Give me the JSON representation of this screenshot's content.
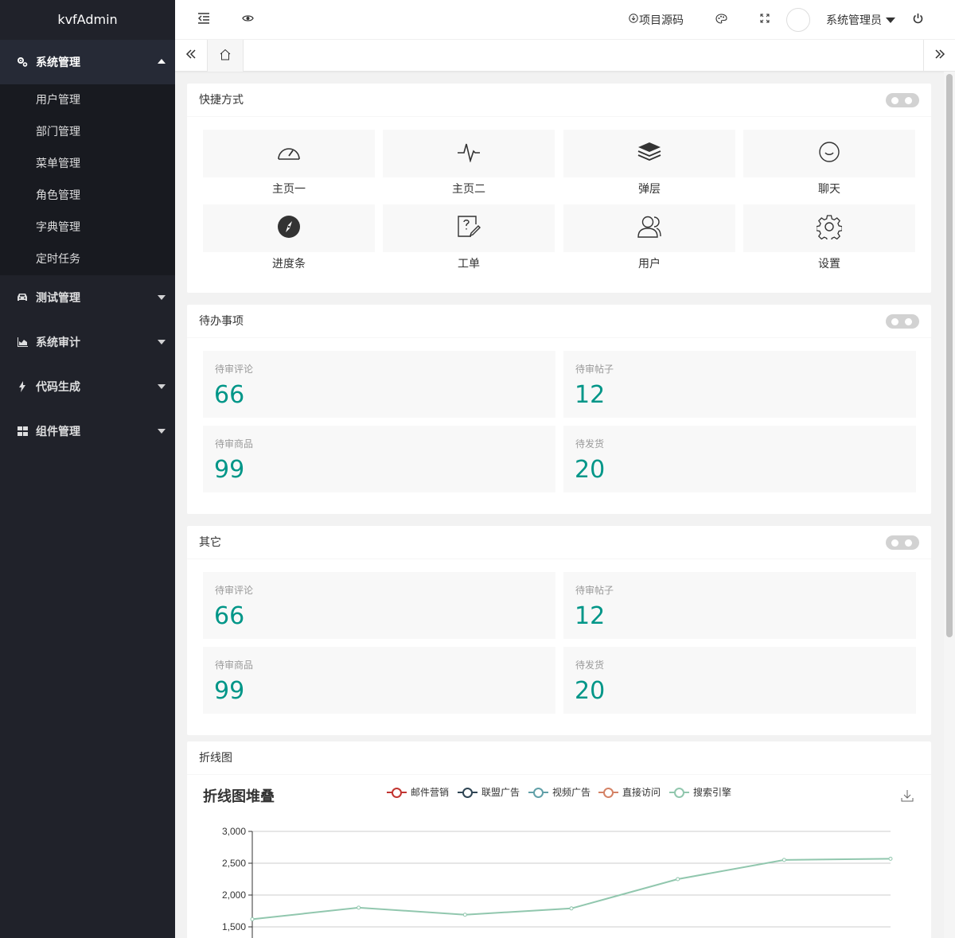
{
  "app": {
    "title": "kvfAdmin"
  },
  "sidebar": {
    "groups": [
      {
        "label": "系统管理",
        "expanded": true,
        "icon": "gears-icon",
        "items": [
          "用户管理",
          "部门管理",
          "菜单管理",
          "角色管理",
          "字典管理",
          "定时任务"
        ]
      },
      {
        "label": "测试管理",
        "expanded": false,
        "icon": "car-icon"
      },
      {
        "label": "系统审计",
        "expanded": false,
        "icon": "area-chart-icon"
      },
      {
        "label": "代码生成",
        "expanded": false,
        "icon": "bolt-icon"
      },
      {
        "label": "组件管理",
        "expanded": false,
        "icon": "grid-icon"
      }
    ]
  },
  "header": {
    "source_link": "项目源码",
    "user_name": "系统管理员"
  },
  "cards": {
    "shortcuts": {
      "title": "快捷方式",
      "items": [
        {
          "label": "主页一",
          "icon": "dashboard-icon"
        },
        {
          "label": "主页二",
          "icon": "chart-pulse-icon"
        },
        {
          "label": "弹层",
          "icon": "layers-icon"
        },
        {
          "label": "聊天",
          "icon": "chat-icon"
        },
        {
          "label": "进度条",
          "icon": "compass-icon"
        },
        {
          "label": "工单",
          "icon": "help-edit-icon"
        },
        {
          "label": "用户",
          "icon": "user-icon"
        },
        {
          "label": "设置",
          "icon": "gear-icon"
        }
      ]
    },
    "todo": {
      "title": "待办事项",
      "items": [
        {
          "label": "待审评论",
          "value": "66"
        },
        {
          "label": "待审帖子",
          "value": "12"
        },
        {
          "label": "待审商品",
          "value": "99"
        },
        {
          "label": "待发货",
          "value": "20"
        }
      ]
    },
    "other": {
      "title": "其它",
      "items": [
        {
          "label": "待审评论",
          "value": "66"
        },
        {
          "label": "待审帖子",
          "value": "12"
        },
        {
          "label": "待审商品",
          "value": "99"
        },
        {
          "label": "待发货",
          "value": "20"
        }
      ]
    },
    "chart": {
      "title": "折线图"
    }
  },
  "colors": {
    "accent": "#009688",
    "sidebar_bg": "#20222a",
    "legend": [
      "#c23531",
      "#2f4554",
      "#61a0a8",
      "#d48265",
      "#91c7ae"
    ]
  },
  "chart_data": {
    "type": "line",
    "title": "折线图堆叠",
    "legend": [
      "邮件营销",
      "联盟广告",
      "视频广告",
      "直接访问",
      "搜索引擎"
    ],
    "legend_placement": "top",
    "ylim": [
      1500,
      3000
    ],
    "yticks": [
      "3,000",
      "2,500",
      "2,000",
      "1,500"
    ],
    "series": [
      {
        "name": "搜索引擎",
        "values": [
          1620,
          1802,
          1691,
          1790,
          2250,
          2552,
          2570
        ]
      }
    ],
    "grid": true
  }
}
